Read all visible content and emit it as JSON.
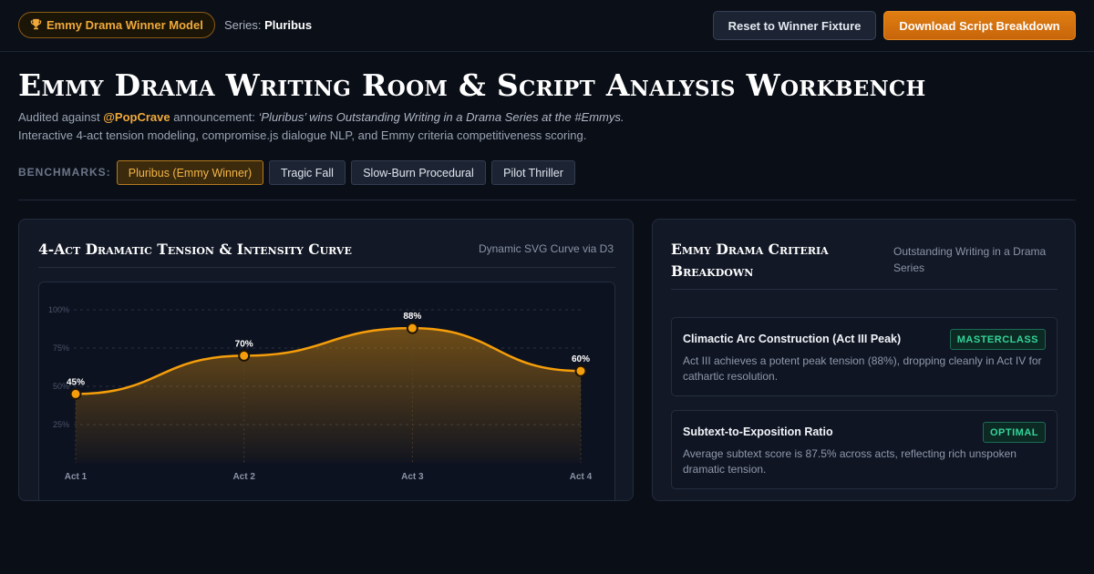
{
  "header": {
    "badge_icon": "trophy-icon",
    "badge_label": "Emmy Drama Winner Model",
    "series_label": "Series:",
    "series_value": "Pluribus",
    "reset_label": "Reset to Winner Fixture",
    "download_label": "Download Script Breakdown"
  },
  "page": {
    "title": "Emmy Drama Writing Room & Script Analysis Workbench",
    "audited_prefix": "Audited against",
    "handle": "@PopCrave",
    "announcement_label": "announcement:",
    "quote": "‘Pluribus’ wins Outstanding Writing in a Drama Series at the #Emmys.",
    "subtitle2": "Interactive 4-act tension modeling, compromise.js dialogue NLP, and Emmy criteria competitiveness scoring."
  },
  "benchmarks": {
    "label": "BENCHMARKS:",
    "items": [
      "Pluribus (Emmy Winner)",
      "Tragic Fall",
      "Slow-Burn Procedural",
      "Pilot Thriller"
    ],
    "active_index": 0
  },
  "tension_panel": {
    "title": "4-Act Dramatic Tension & Intensity Curve",
    "meta": "Dynamic SVG Curve via D3"
  },
  "chart_data": {
    "type": "area",
    "categories": [
      "Act 1",
      "Act 2",
      "Act 3",
      "Act 4"
    ],
    "values": [
      45,
      70,
      88,
      60
    ],
    "data_labels": [
      "45%",
      "70%",
      "88%",
      "60%"
    ],
    "ytick_labels": [
      "25%",
      "50%",
      "75%",
      "100%"
    ],
    "yticks": [
      25,
      50,
      75,
      100
    ],
    "ylim": [
      0,
      100
    ],
    "grid": true,
    "colors": {
      "line": "#f59e0b",
      "point_stroke": "#1f1505",
      "fill_top": "#f59e0b"
    }
  },
  "criteria_panel": {
    "title": "Emmy Drama Criteria Breakdown",
    "meta": "Outstanding Writing in a Drama Series",
    "items": [
      {
        "name": "Climactic Arc Construction (Act III Peak)",
        "tag": "MASTERCLASS",
        "desc": "Act III achieves a potent peak tension (88%), dropping cleanly in Act IV for cathartic resolution."
      },
      {
        "name": "Subtext-to-Exposition Ratio",
        "tag": "OPTIMAL",
        "desc": "Average subtext score is 87.5% across acts, reflecting rich unspoken dramatic tension."
      }
    ]
  }
}
